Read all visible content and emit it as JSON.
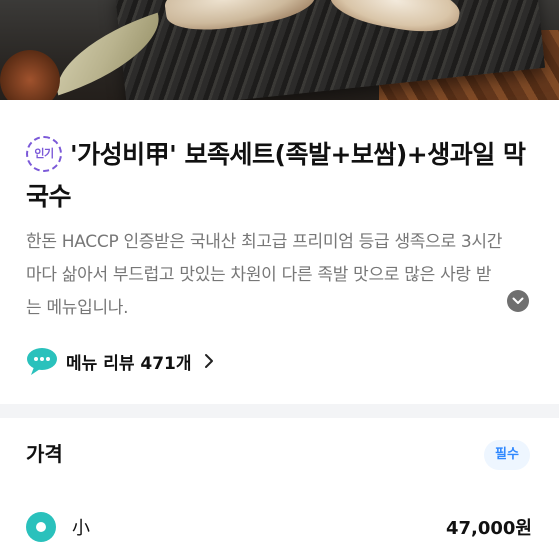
{
  "menu": {
    "badge": "인기",
    "title": "'가성비甲' 보족세트(족발+보쌈)+생과일 막국수",
    "description": "한돈 HACCP 인증받은 국내산 최고급 프리미엄 등급 생족으로 3시간마다 삶아서 부드럽고 맛있는 차원이 다른 족발 맛으로 많은 사랑 받는 메뉴입니나."
  },
  "review": {
    "label": "메뉴 리뷰 471개"
  },
  "price_section": {
    "title": "가격",
    "required_badge": "필수",
    "options": [
      {
        "name": "小",
        "price": "47,000원",
        "selected": true
      }
    ]
  },
  "colors": {
    "badge_purple": "#7b59d8",
    "radio_teal": "#2ac1bc",
    "required_blue": "#2f88ff",
    "review_icon": "#2ac1bc"
  },
  "icons": {
    "expand": "chevron-down-icon",
    "review_bubble": "speech-bubble-icon",
    "review_arrow": "chevron-right-icon"
  }
}
